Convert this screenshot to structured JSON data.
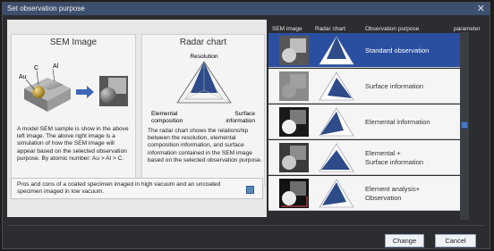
{
  "window": {
    "title": "Set observation purpose"
  },
  "sem_panel": {
    "title": "SEM Image",
    "labels": {
      "c": "C",
      "al": "Al",
      "au": "Au"
    },
    "description": "A model SEM sample is show in the above left image. The above right image is a simulation of how the SEM image will appear based on the selected observation purpose. By atomic number: Au > Al > C."
  },
  "radar_panel": {
    "title": "Radar chart",
    "axis_resolution": "Resolution",
    "axis_elemental": "Elemental composition",
    "axis_surface": "Surface information",
    "description": "The radar chart shows the relationship between the resolution, elemental composition information, and surface information contained in the SEM image based on the selected observation purpose."
  },
  "note": {
    "text": "Pros and cons of a coated specimen imaged in high vacuum and an uncoated specimen imaged in low vacuum."
  },
  "list": {
    "headers": {
      "sem_image": "SEM image",
      "radar_chart": "Radar chart",
      "purpose": "Observation purpose",
      "parameter": "parameter"
    },
    "items": [
      {
        "label": "Standard observation",
        "selected": true
      },
      {
        "label": "Surface information",
        "selected": false
      },
      {
        "label": "Elemental information",
        "selected": false
      },
      {
        "label": "Elemental +\nSurface information",
        "selected": false
      },
      {
        "label": "Element analysis+\nObservation",
        "selected": false
      }
    ]
  },
  "buttons": {
    "change": "Change",
    "cancel": "Cancel"
  },
  "colors": {
    "selection": "#2a4fa0",
    "radar_fill": "#2e4c8a",
    "accent": "#4a78c0"
  }
}
